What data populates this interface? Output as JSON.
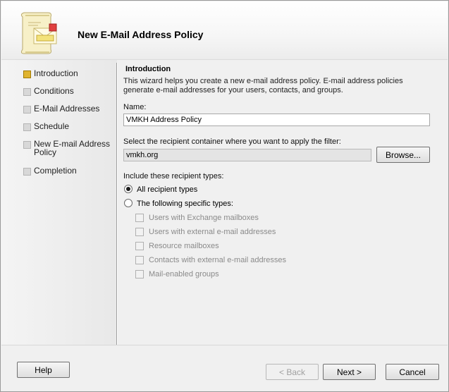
{
  "wizard": {
    "title": "New E-Mail Address Policy"
  },
  "steps": [
    {
      "label": "Introduction",
      "active": true
    },
    {
      "label": "Conditions",
      "active": false
    },
    {
      "label": "E-Mail Addresses",
      "active": false
    },
    {
      "label": "Schedule",
      "active": false
    },
    {
      "label": "New E-mail Address Policy",
      "active": false
    },
    {
      "label": "Completion",
      "active": false
    }
  ],
  "intro": {
    "heading": "Introduction",
    "description": "This wizard helps you create a new e-mail address policy. E-mail address policies generate e-mail addresses for your users, contacts, and groups.",
    "name_label": "Name:",
    "name_value": "VMKH Address Policy",
    "container_label": "Select the recipient container where you want to apply the filter:",
    "container_value": "vmkh.org",
    "browse_label": "Browse...",
    "recipients_label": "Include these recipient types:",
    "radio_all": "All recipient types",
    "radio_specific": "The following specific types:",
    "types": [
      "Users with Exchange mailboxes",
      "Users with external e-mail addresses",
      "Resource mailboxes",
      "Contacts with external e-mail addresses",
      "Mail-enabled groups"
    ]
  },
  "footer": {
    "help": "Help",
    "back": "< Back",
    "next": "Next >",
    "cancel": "Cancel"
  }
}
